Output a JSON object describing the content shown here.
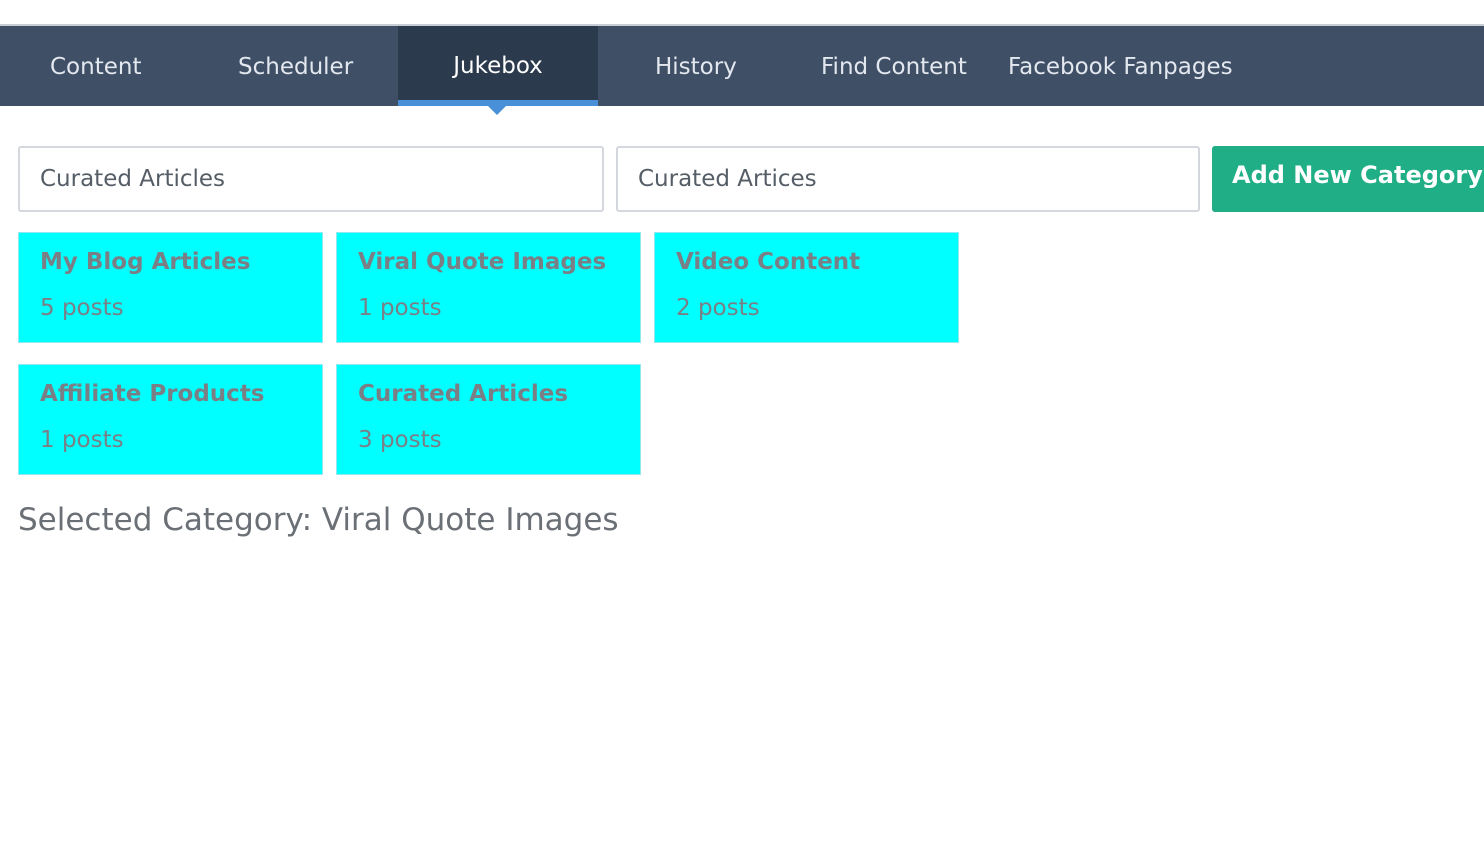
{
  "nav": {
    "tabs": [
      {
        "label": "Content"
      },
      {
        "label": "Scheduler"
      },
      {
        "label": "Jukebox"
      },
      {
        "label": "History"
      },
      {
        "label": "Find Content"
      },
      {
        "label": "Facebook Fanpages"
      }
    ],
    "active_tab": "Jukebox"
  },
  "form": {
    "input1_value": "Curated Articles",
    "input2_value": "Curated Artices",
    "add_button_label": "Add New Category"
  },
  "categories": [
    {
      "name": "My Blog Articles",
      "count": "5 posts"
    },
    {
      "name": "Viral Quote Images",
      "count": "1 posts"
    },
    {
      "name": "Video Content",
      "count": "2 posts"
    },
    {
      "name": "Affiliate Products",
      "count": "1 posts"
    },
    {
      "name": "Curated Articles",
      "count": "3 posts"
    }
  ],
  "selected": {
    "text": "Selected Category: Viral Quote Images"
  },
  "colors": {
    "navbar": "#3f4f66",
    "navbar_active": "#2c3a4d",
    "active_indicator": "#4a90d9",
    "card": "#00ffff",
    "button": "#1fae85"
  }
}
